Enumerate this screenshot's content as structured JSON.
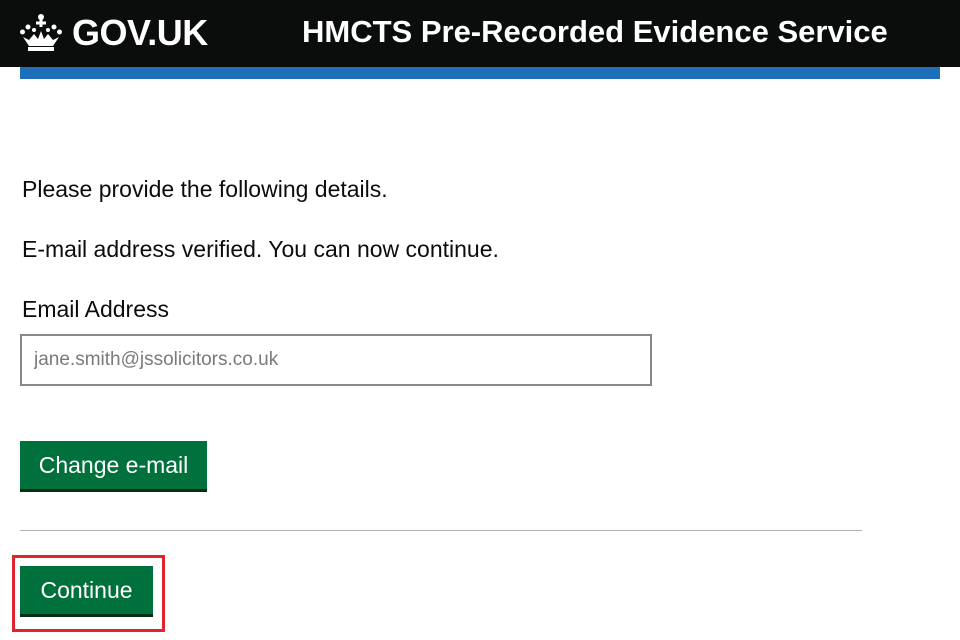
{
  "header": {
    "logo_text": "GOV.UK",
    "logo_icon": "crown-icon",
    "service_name": "HMCTS Pre-Recorded Evidence Service"
  },
  "main": {
    "intro_text": "Please provide the following details.",
    "verified_message": "E-mail address verified. You can now continue.",
    "email_label": "Email Address",
    "email_value": "jane.smith@jssolicitors.co.uk",
    "change_email_label": "Change e-mail",
    "continue_label": "Continue"
  },
  "colors": {
    "header_bg": "#0b0c0c",
    "header_bar": "#1d70b8",
    "button_green": "#00703c",
    "highlight_red": "#e0232e"
  }
}
